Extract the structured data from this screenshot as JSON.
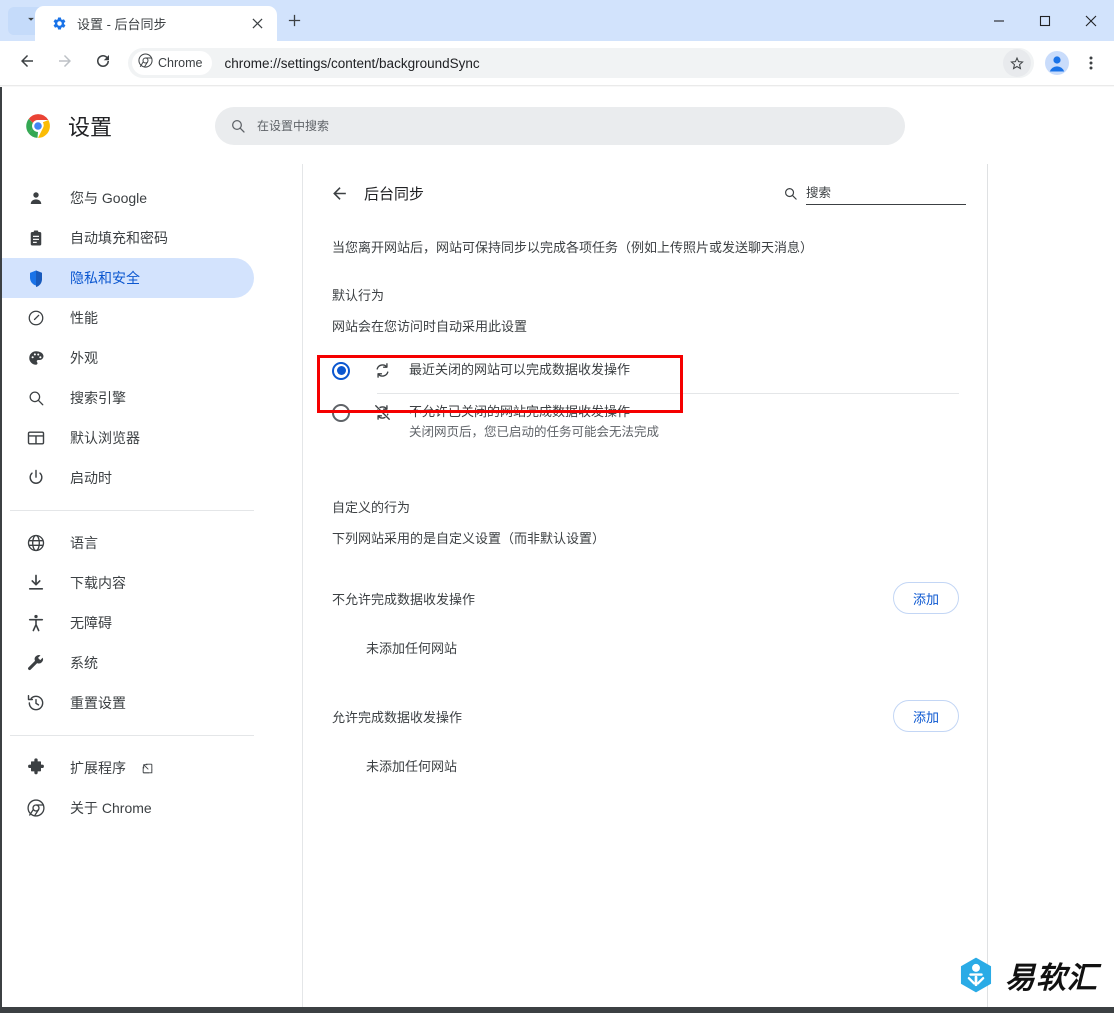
{
  "window": {
    "minimize_label": "−",
    "maximize_label": "□",
    "close_label": "✕"
  },
  "tabstrip": {
    "tab_search_icon": "chevron-down-icon",
    "tabs": [
      {
        "title": "设置 - 后台同步",
        "favicon": "settings-gear-icon",
        "close_label": "✕"
      }
    ],
    "new_tab_label": "+"
  },
  "toolbar": {
    "back_icon": "arrow-left-icon",
    "forward_icon": "arrow-right-icon",
    "reload_icon": "reload-icon",
    "chip_label": "Chrome",
    "chip_icon": "chrome-icon",
    "url": "chrome://settings/content/backgroundSync",
    "star_icon": "star-icon",
    "profile_icon": "profile-avatar-icon",
    "menu_icon": "three-dot-menu-icon"
  },
  "settings_header": {
    "logo_icon": "chrome-logo-icon",
    "title": "设置",
    "search_icon": "search-icon",
    "search_placeholder": "在设置中搜索",
    "search_value": ""
  },
  "sidebar": {
    "groups": [
      {
        "items": [
          {
            "label": "您与 Google",
            "icon": "person-icon",
            "active": false
          },
          {
            "label": "自动填充和密码",
            "icon": "clipboard-icon",
            "active": false
          },
          {
            "label": "隐私和安全",
            "icon": "shield-icon",
            "active": true
          },
          {
            "label": "性能",
            "icon": "speedometer-icon",
            "active": false
          },
          {
            "label": "外观",
            "icon": "palette-icon",
            "active": false
          },
          {
            "label": "搜索引擎",
            "icon": "search-icon",
            "active": false
          },
          {
            "label": "默认浏览器",
            "icon": "browser-window-icon",
            "active": false
          },
          {
            "label": "启动时",
            "icon": "power-icon",
            "active": false
          }
        ]
      },
      {
        "items": [
          {
            "label": "语言",
            "icon": "globe-icon",
            "active": false
          },
          {
            "label": "下载内容",
            "icon": "download-icon",
            "active": false
          },
          {
            "label": "无障碍",
            "icon": "accessibility-icon",
            "active": false
          },
          {
            "label": "系统",
            "icon": "wrench-icon",
            "active": false
          },
          {
            "label": "重置设置",
            "icon": "history-restore-icon",
            "active": false
          }
        ]
      },
      {
        "items": [
          {
            "label": "扩展程序",
            "icon": "puzzle-icon",
            "active": false,
            "external": true
          },
          {
            "label": "关于 Chrome",
            "icon": "chrome-icon",
            "active": false
          }
        ]
      }
    ]
  },
  "main": {
    "back_icon": "arrow-left-icon",
    "title": "后台同步",
    "search_icon": "search-icon",
    "search_placeholder": "搜索",
    "search_value": "",
    "description": "当您离开网站后，网站可保持同步以完成各项任务（例如上传照片或发送聊天消息）",
    "default_behavior_label": "默认行为",
    "default_behavior_sub": "网站会在您访问时自动采用此设置",
    "radio_options": [
      {
        "label": "最近关闭的网站可以完成数据收发操作",
        "sublabel": "",
        "icon": "sync-icon",
        "selected": true,
        "highlighted": true
      },
      {
        "label": "不允许已关闭的网站完成数据收发操作",
        "sublabel": "关闭网页后，您已启动的任务可能会无法完成",
        "icon": "sync-off-icon",
        "selected": false,
        "highlighted": false
      }
    ],
    "custom_behavior_label": "自定义的行为",
    "custom_behavior_sub": "下列网站采用的是自定义设置（而非默认设置）",
    "permission_sections": [
      {
        "label": "不允许完成数据收发操作",
        "add_label": "添加",
        "empty_text": "未添加任何网站"
      },
      {
        "label": "允许完成数据收发操作",
        "add_label": "添加",
        "empty_text": "未添加任何网站"
      }
    ]
  },
  "watermark": {
    "text": "易软汇",
    "icon": "hexagon-badge-icon",
    "color": "#2aabe6"
  },
  "colors": {
    "accent": "#0b57d0",
    "titlebar": "#d2e3fc",
    "active_nav_bg": "#d3e3fd",
    "highlight_red": "#f50000",
    "text_primary": "#3c4043",
    "text_secondary": "#5f6368"
  }
}
